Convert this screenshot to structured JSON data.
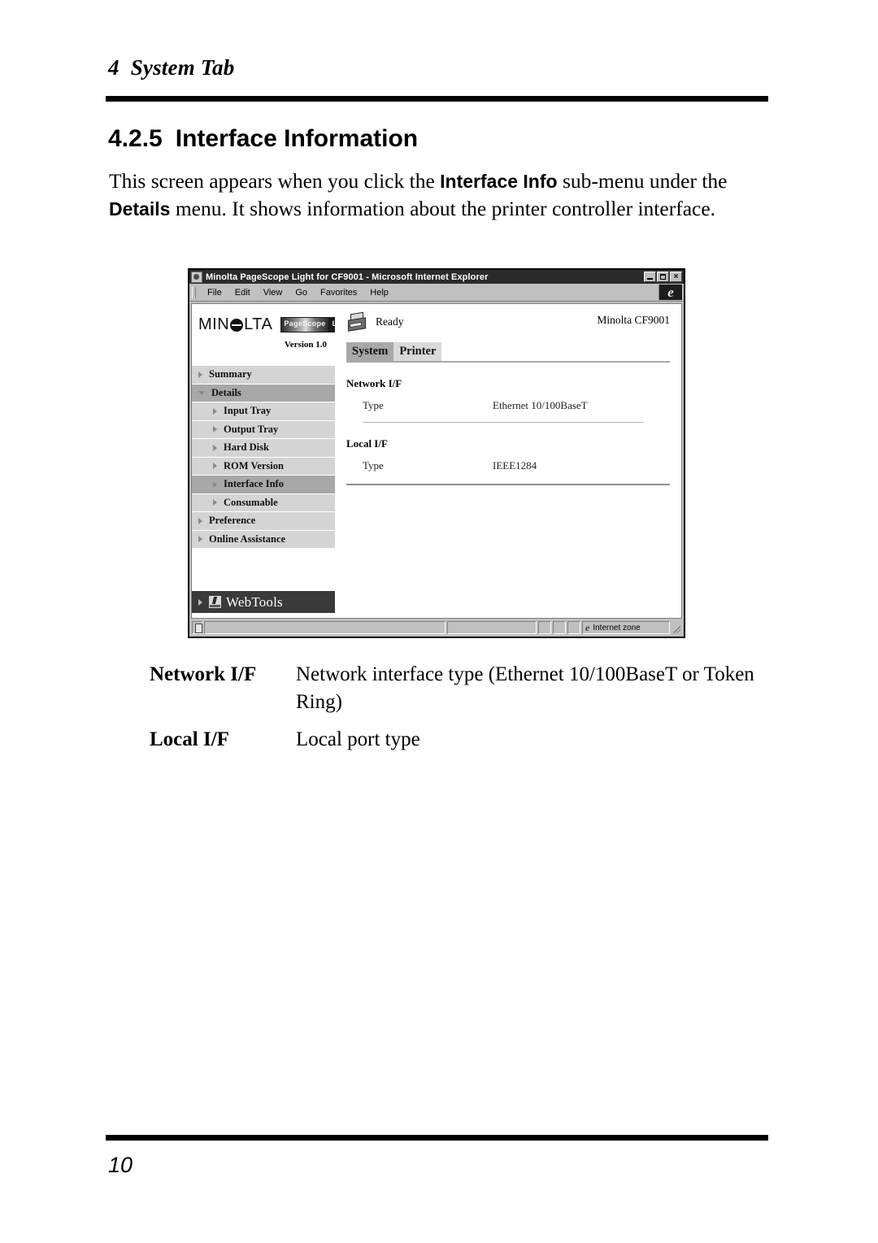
{
  "page": {
    "running_head_number": "4",
    "running_head_title": "System Tab",
    "section_number": "4.2.5",
    "section_title": "Interface Information",
    "folio": "10"
  },
  "intro": {
    "part1": "This screen appears when you click the ",
    "bold1": "Interface Info",
    "part2": " sub-menu under the ",
    "bold2": "Details",
    "part3": " menu. It shows information about the printer controller interface."
  },
  "definitions": [
    {
      "term": "Network I/F",
      "description": "Network interface type (Ethernet 10/100BaseT or Token Ring)"
    },
    {
      "term": "Local I/F",
      "description": "Local port type"
    }
  ],
  "browser": {
    "title": "Minolta PageScope Light for CF9001 - Microsoft Internet Explorer",
    "window_buttons": [
      "minimize",
      "maximize",
      "close"
    ],
    "menu": [
      "File",
      "Edit",
      "View",
      "Go",
      "Favorites",
      "Help"
    ],
    "brand": {
      "company": "MIN",
      "company_suffix": "LTA",
      "product": "PageScope",
      "product_edition": "Light",
      "version": "Version 1.0"
    },
    "nav": [
      {
        "label": "Summary",
        "level": 1,
        "selected": false,
        "expanded": false
      },
      {
        "label": "Details",
        "level": 1,
        "selected": true,
        "expanded": true
      },
      {
        "label": "Input Tray",
        "level": 2,
        "selected": false,
        "expanded": false
      },
      {
        "label": "Output Tray",
        "level": 2,
        "selected": false,
        "expanded": false
      },
      {
        "label": "Hard Disk",
        "level": 2,
        "selected": false,
        "expanded": false
      },
      {
        "label": "ROM Version",
        "level": 2,
        "selected": false,
        "expanded": false
      },
      {
        "label": "Interface Info",
        "level": 2,
        "selected": true,
        "expanded": false
      },
      {
        "label": "Consumable",
        "level": 2,
        "selected": false,
        "expanded": false
      },
      {
        "label": "Preference",
        "level": 1,
        "selected": false,
        "expanded": false
      },
      {
        "label": "Online Assistance",
        "level": 1,
        "selected": false,
        "expanded": false
      }
    ],
    "webtools_label": "WebTools",
    "status": "Ready",
    "model": "Minolta CF9001",
    "tabs": [
      {
        "label": "System",
        "active": true
      },
      {
        "label": "Printer",
        "active": false
      }
    ],
    "content": {
      "network_section_title": "Network I/F",
      "network_type_label": "Type",
      "network_type_value": "Ethernet 10/100BaseT",
      "local_section_title": "Local I/F",
      "local_type_label": "Type",
      "local_type_value": "IEEE1284"
    },
    "statusbar": {
      "zone": "Internet zone"
    }
  }
}
